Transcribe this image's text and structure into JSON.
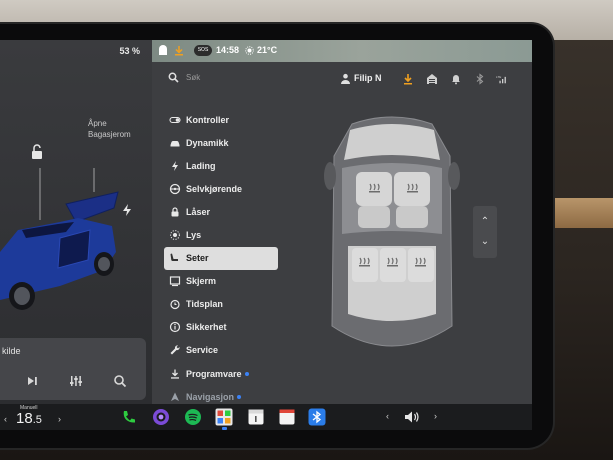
{
  "status": {
    "battery": "53 %",
    "badge": "SOS",
    "time": "14:58",
    "temperature": "21°C"
  },
  "car_panel": {
    "trunk_label": [
      "Åpne",
      "Bagasjerom"
    ],
    "media_source": "kilde",
    "icons": [
      "lock-open-icon",
      "charge-bolt-icon",
      "next-track-icon",
      "equalizer-icon",
      "search-icon"
    ]
  },
  "header": {
    "search_placeholder": "Søk",
    "user_name": "Filip N",
    "icons": [
      "download-icon",
      "garage-icon",
      "bell-icon",
      "bluetooth-icon",
      "lte-signal-icon"
    ]
  },
  "menu": {
    "items": [
      {
        "label": "Kontroller",
        "icon": "toggle-icon"
      },
      {
        "label": "Dynamikk",
        "icon": "car-icon"
      },
      {
        "label": "Lading",
        "icon": "bolt-icon"
      },
      {
        "label": "Selvkjørende",
        "icon": "steering-wheel-icon"
      },
      {
        "label": "Låser",
        "icon": "lock-icon"
      },
      {
        "label": "Lys",
        "icon": "sun-icon"
      },
      {
        "label": "Seter",
        "icon": "seat-icon",
        "active": true
      },
      {
        "label": "Skjerm",
        "icon": "display-icon"
      },
      {
        "label": "Tidsplan",
        "icon": "alarm-clock-icon"
      },
      {
        "label": "Sikkerhet",
        "icon": "info-circle-icon"
      },
      {
        "label": "Service",
        "icon": "wrench-icon"
      },
      {
        "label": "Programvare",
        "icon": "download-icon",
        "dot": true
      },
      {
        "label": "Navigasjon",
        "icon": "navigation-arrow-icon",
        "dot": true
      }
    ]
  },
  "dock": {
    "temp_mode": "Manuell",
    "temp_value": "18",
    "temp_decimal": ".5",
    "apps": [
      "phone-icon",
      "camera-icon",
      "spotify-icon",
      "apps-launcher-icon",
      "calendar-icon",
      "notes-icon",
      "bluetooth-icon"
    ],
    "volume_icon": "volume-icon"
  },
  "colors": {
    "accent_blue": "#3b82f6",
    "active_menu_bg": "#dedede",
    "car_body_blue": "#1d3a9a",
    "spotify_green": "#1db954",
    "phone_green": "#2ecc40"
  }
}
